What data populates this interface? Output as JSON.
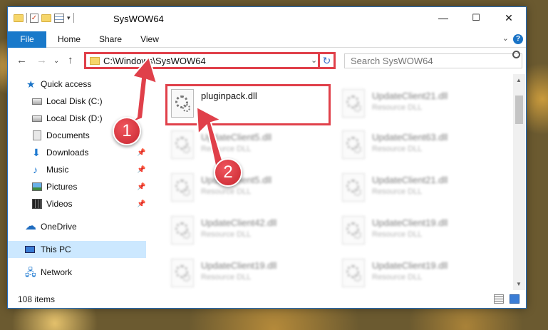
{
  "window": {
    "title": "SysWOW64"
  },
  "ribbon": {
    "tabs": [
      {
        "label": "File"
      },
      {
        "label": "Home"
      },
      {
        "label": "Share"
      },
      {
        "label": "View"
      }
    ]
  },
  "window_controls": {
    "minimize": "—",
    "maximize": "☐",
    "close": "✕"
  },
  "address_bar": {
    "path": "C:\\Windows\\SysWOW64",
    "refresh": "↻"
  },
  "search": {
    "placeholder": "Search SysWOW64"
  },
  "sidebar": {
    "items": [
      {
        "label": "Quick access",
        "icon": "star-icon"
      },
      {
        "label": "Local Disk (C:)",
        "icon": "disk-icon"
      },
      {
        "label": "Local Disk (D:)",
        "icon": "disk-icon"
      },
      {
        "label": "Documents",
        "icon": "documents-icon"
      },
      {
        "label": "Downloads",
        "icon": "downloads-icon",
        "pinned": true
      },
      {
        "label": "Music",
        "icon": "music-icon",
        "pinned": true
      },
      {
        "label": "Pictures",
        "icon": "pictures-icon",
        "pinned": true
      },
      {
        "label": "Videos",
        "icon": "videos-icon",
        "pinned": true
      },
      {
        "label": "OneDrive",
        "icon": "cloud-icon"
      },
      {
        "label": "This PC",
        "icon": "computer-icon",
        "selected": true
      },
      {
        "label": "Network",
        "icon": "network-icon"
      }
    ]
  },
  "files": [
    {
      "name": "pluginpack.dll",
      "type": ""
    },
    {
      "name": "UpdateClient21.dll",
      "type": "Resource DLL"
    },
    {
      "name": "UpdateClient5.dll",
      "type": "Resource DLL"
    },
    {
      "name": "UpdateClient63.dll",
      "type": "Resource DLL"
    },
    {
      "name": "UpdateClient5.dll",
      "type": "Resource DLL"
    },
    {
      "name": "UpdateClient21.dll",
      "type": "Resource DLL"
    },
    {
      "name": "UpdateClient42.dll",
      "type": "Resource DLL"
    },
    {
      "name": "UpdateClient19.dll",
      "type": "Resource DLL"
    },
    {
      "name": "UpdateClient19.dll",
      "type": "Resource DLL"
    },
    {
      "name": "UpdateClient19.dll",
      "type": "Resource DLL"
    }
  ],
  "status_bar": {
    "item_count": "108 items"
  },
  "callouts": {
    "first": "1",
    "second": "2"
  },
  "colors": {
    "accent": "#1979ca",
    "highlight": "#e0404a",
    "selected": "#cce8ff"
  }
}
